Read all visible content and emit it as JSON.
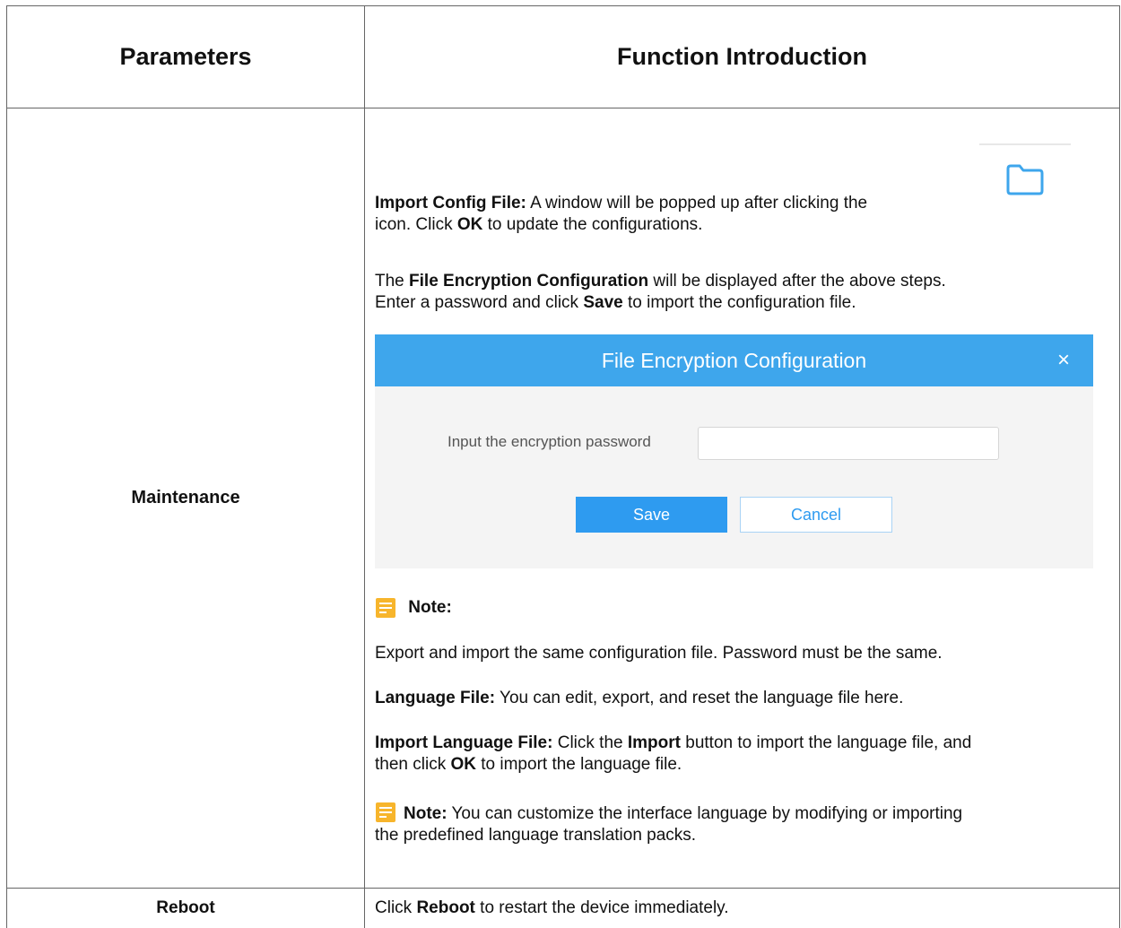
{
  "header": {
    "col1": "Parameters",
    "col2": "Function Introduction"
  },
  "rows": [
    {
      "param": "Maintenance"
    },
    {
      "param": "Reboot"
    }
  ],
  "maintenance": {
    "import_config": {
      "label": "Import Config File:",
      "text1": " A window will be popped up after clicking the",
      "text2": "icon. Click ",
      "ok": "OK",
      "text3": " to update the configurations."
    },
    "encryption_para": {
      "t1": "The ",
      "b1": "File Encryption Configuration",
      "t2": " will be displayed after the above steps.",
      "t3": "Enter a password and click ",
      "b2": "Save",
      "t4": " to import the configuration file."
    },
    "dialog": {
      "title": "File Encryption Configuration",
      "close_glyph": "×",
      "password_label": "Input the encryption password",
      "password_value": "",
      "save_label": "Save",
      "cancel_label": "Cancel"
    },
    "note_title": "Note:",
    "note_text": "Export and import the same configuration file. Password must be the same.",
    "language_file": {
      "label": "Language File:",
      "text": "  You can edit, export, and reset the language file here."
    },
    "import_language": {
      "label": "Import Language File:",
      "t1": " Click the ",
      "b1": "Import",
      "t2": " button to import the language file, and",
      "t3": "then click ",
      "b2": "OK",
      "t4": " to import the language file."
    },
    "note2": {
      "label": "Note:",
      "text1": "  You can customize the interface language by modifying or importing",
      "text2": "the predefined language translation packs."
    }
  },
  "reboot": {
    "t1": "Click ",
    "b1": "Reboot",
    "t2": " to restart the device immediately."
  },
  "colors": {
    "dialog_header": "#3ea6ec",
    "save_button": "#2e9bf0",
    "note_icon": "#f7b52c",
    "folder_icon": "#3ea6ec"
  },
  "icons": [
    "folder-icon",
    "note-icon",
    "close-icon"
  ]
}
